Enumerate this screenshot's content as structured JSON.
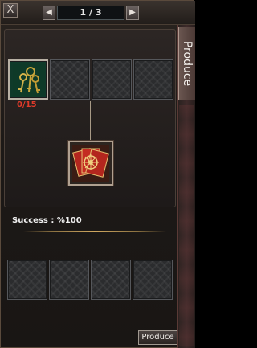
{
  "window": {
    "close_label": "X"
  },
  "pager": {
    "prev_label": "◀",
    "next_label": "▶",
    "page_text": "1 / 3"
  },
  "side_tab": {
    "label": "Produce"
  },
  "material": {
    "icon": "keys-icon",
    "count": "0/15"
  },
  "result": {
    "icon": "cards-icon"
  },
  "success": {
    "text": "Success : %100"
  },
  "footer": {
    "produce_button": "Produce"
  },
  "colors": {
    "count_red": "#e03a2a",
    "gold_line": "#d0a860",
    "slot_green": "#0f3a2a"
  }
}
